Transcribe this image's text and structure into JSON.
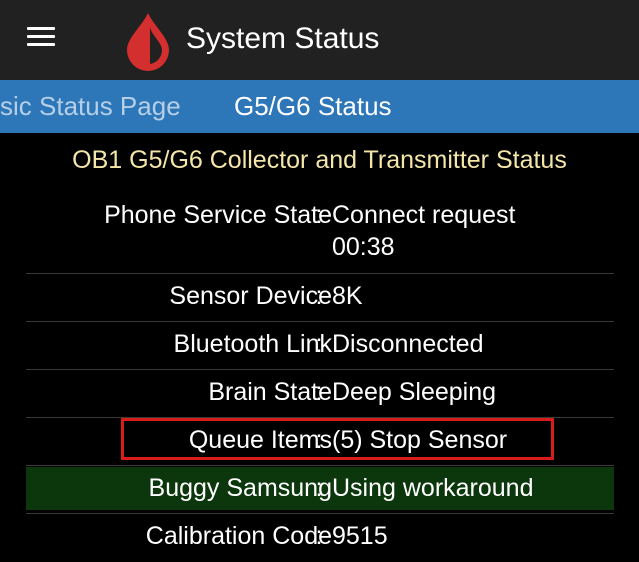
{
  "app_bar": {
    "title": "System Status",
    "menu_icon": "hamburger-menu-icon",
    "logo_icon": "blood-drop-icon",
    "logo_color": "#d32f2f"
  },
  "tabs": [
    {
      "label": "ssic Status Page",
      "selected": false
    },
    {
      "label": "G5/G6 Status",
      "selected": true
    }
  ],
  "tab_bar_color": "#2d76b8",
  "heading": "OB1 G5/G6 Collector and Transmitter Status",
  "status_rows": [
    {
      "label": "Phone Service State",
      "value_line1": "Connect request",
      "value_line2": "00:38"
    },
    {
      "label": "Sensor Device",
      "value": "8K"
    },
    {
      "label": "Bluetooth Link",
      "value": "Disconnected"
    },
    {
      "label": "Brain State",
      "value": "Deep Sleeping"
    },
    {
      "label": "Queue Items",
      "value": "(5) Stop Sensor",
      "highlighted": true
    },
    {
      "label": "Buggy Samsung",
      "value": "Using workaround",
      "row_color": "#0c360c"
    },
    {
      "label": "Calibration Code",
      "value": "9515"
    }
  ],
  "separator": ":",
  "highlight_color": "#d81b1b"
}
